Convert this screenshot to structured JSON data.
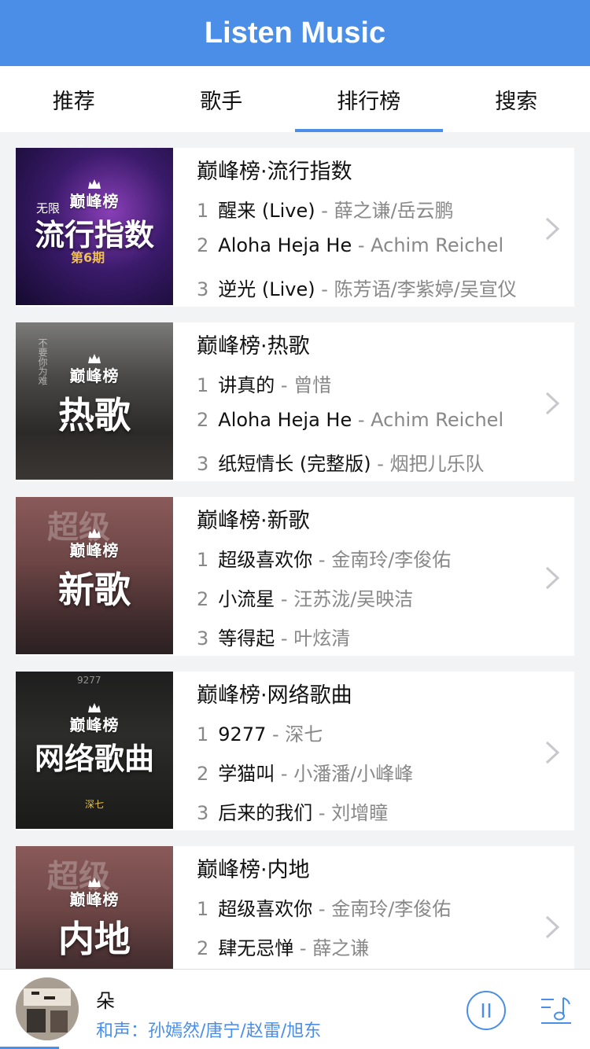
{
  "header": {
    "title": "Listen Music"
  },
  "tabs": [
    {
      "label": "推荐",
      "active": false
    },
    {
      "label": "歌手",
      "active": false
    },
    {
      "label": "排行榜",
      "active": true
    },
    {
      "label": "搜索",
      "active": false
    }
  ],
  "cover_brand": "巅峰榜",
  "charts": [
    {
      "title": "巅峰榜·流行指数",
      "cover_text": "流行指数",
      "cover_extra": [
        "无限",
        "第6期"
      ],
      "songs": [
        {
          "rank": "1",
          "name": "醒来 (Live)",
          "artist": "薛之谦/岳云鹏"
        },
        {
          "rank": "2",
          "name": "Aloha Heja He",
          "artist": "Achim Reichel"
        },
        {
          "rank": "3",
          "name": "逆光 (Live)",
          "artist": "陈芳语/李紫婷/吴宣仪"
        }
      ]
    },
    {
      "title": "巅峰榜·热歌",
      "cover_text": "热歌",
      "cover_extra": [
        "不要你为难"
      ],
      "songs": [
        {
          "rank": "1",
          "name": "讲真的",
          "artist": "曾惜"
        },
        {
          "rank": "2",
          "name": "Aloha Heja He",
          "artist": "Achim Reichel"
        },
        {
          "rank": "3",
          "name": "纸短情长 (完整版)",
          "artist": "烟把儿乐队"
        }
      ]
    },
    {
      "title": "巅峰榜·新歌",
      "cover_text": "新歌",
      "cover_extra": [
        "超级"
      ],
      "songs": [
        {
          "rank": "1",
          "name": "超级喜欢你",
          "artist": "金南玲/李俊佑"
        },
        {
          "rank": "2",
          "name": "小流星",
          "artist": "汪苏泷/吴映洁"
        },
        {
          "rank": "3",
          "name": "等得起",
          "artist": "叶炫清"
        }
      ]
    },
    {
      "title": "巅峰榜·网络歌曲",
      "cover_text": "网络歌曲",
      "cover_extra": [
        "9277",
        "深七"
      ],
      "songs": [
        {
          "rank": "1",
          "name": "9277",
          "artist": "深七"
        },
        {
          "rank": "2",
          "name": "学猫叫",
          "artist": "小潘潘/小峰峰"
        },
        {
          "rank": "3",
          "name": "后来的我们",
          "artist": "刘增瞳"
        }
      ]
    },
    {
      "title": "巅峰榜·内地",
      "cover_text": "内地",
      "cover_extra": [
        "超级"
      ],
      "songs": [
        {
          "rank": "1",
          "name": "超级喜欢你",
          "artist": "金南玲/李俊佑"
        },
        {
          "rank": "2",
          "name": "肆无忌惮",
          "artist": "薛之谦"
        }
      ]
    }
  ],
  "player": {
    "song": "朵",
    "artist": "和声：孙嫣然/唐宁/赵雷/旭东",
    "progress_percent": 10
  },
  "colors": {
    "accent": "#4a8ee8",
    "muted": "#888888"
  },
  "icons": [
    "chevron-right-icon",
    "pause-icon",
    "playlist-icon",
    "crown-icon"
  ]
}
